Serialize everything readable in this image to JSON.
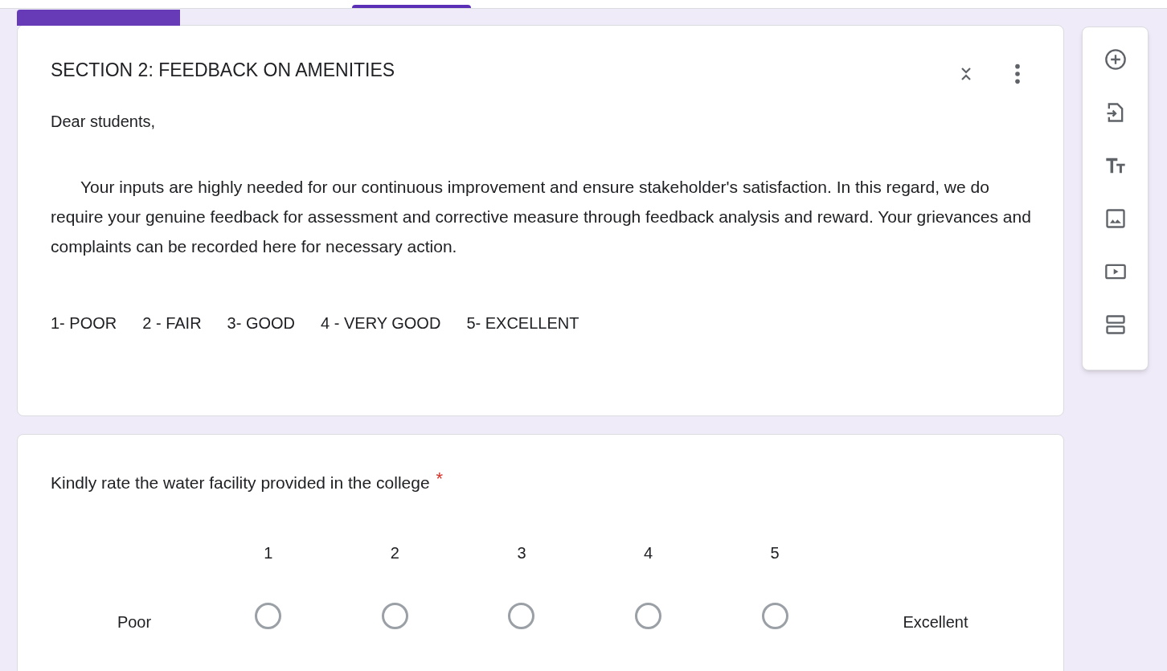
{
  "section": {
    "title": "SECTION 2: FEEDBACK ON AMENITIES",
    "greeting": "Dear students,",
    "description": "Your inputs are highly needed for our continuous improvement and ensure stakeholder's satisfaction. In this regard, we do require your genuine feedback for assessment and corrective measure through feedback analysis and reward. Your grievances and complaints can be recorded here for necessary action.",
    "scale_legend": [
      "1- POOR",
      "2 - FAIR",
      "3- GOOD",
      "4 - VERY GOOD",
      "5- EXCELLENT"
    ]
  },
  "question": {
    "title": "Kindly rate the water facility provided in the college",
    "required_mark": "*",
    "low_label": "Poor",
    "high_label": "Excellent",
    "options": [
      {
        "label": "1",
        "selected": false
      },
      {
        "label": "2",
        "selected": false
      },
      {
        "label": "3",
        "selected": false
      },
      {
        "label": "4",
        "selected": false
      },
      {
        "label": "5",
        "selected": false
      }
    ]
  }
}
